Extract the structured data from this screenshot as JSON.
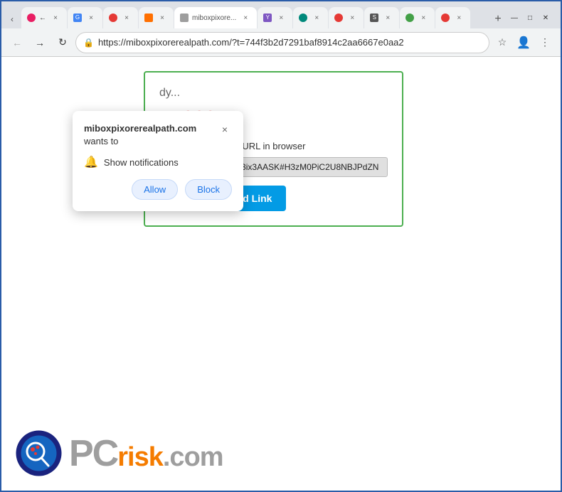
{
  "browser": {
    "url": "https://miboxpixorerealpath.com/?t=744f3b2d7291baf8914c2aa6667e0aa2",
    "tabs": [
      {
        "id": 1,
        "title": "◀",
        "active": false,
        "favicon": "◀"
      },
      {
        "id": 2,
        "title": "G",
        "active": false,
        "favicon": "G"
      },
      {
        "id": 3,
        "title": "●",
        "active": false,
        "favicon": "●"
      },
      {
        "id": 4,
        "title": "◉",
        "active": false,
        "favicon": "◉"
      },
      {
        "id": 5,
        "title": "",
        "active": true,
        "favicon": "×"
      },
      {
        "id": 6,
        "title": "Y",
        "active": false,
        "favicon": "Y"
      }
    ],
    "window_controls": {
      "minimize": "—",
      "maximize": "□",
      "close": "✕"
    }
  },
  "notification_popup": {
    "title_domain": "miboxpixorerealpath.com",
    "title_suffix": " wants to",
    "notification_label": "Show notifications",
    "allow_label": "Allow",
    "block_label": "Block",
    "close_label": "×"
  },
  "page": {
    "loading_text": "dy...",
    "year_text": "s: 2025",
    "instruction": "Copy and paste the URL in browser",
    "download_url": "https://mega.nz/file/3ix3AASK#H3zM0PiC2U8NBJPdZN",
    "copy_button_label": "Copy Download Link"
  },
  "watermark": {
    "pc_text": "PC",
    "risk_text": "risk",
    "com_text": ".com"
  },
  "icons": {
    "back": "←",
    "forward": "→",
    "refresh": "↻",
    "secure": "🔒",
    "star": "☆",
    "profile": "👤",
    "more": "⋮",
    "bell": "🔔"
  }
}
